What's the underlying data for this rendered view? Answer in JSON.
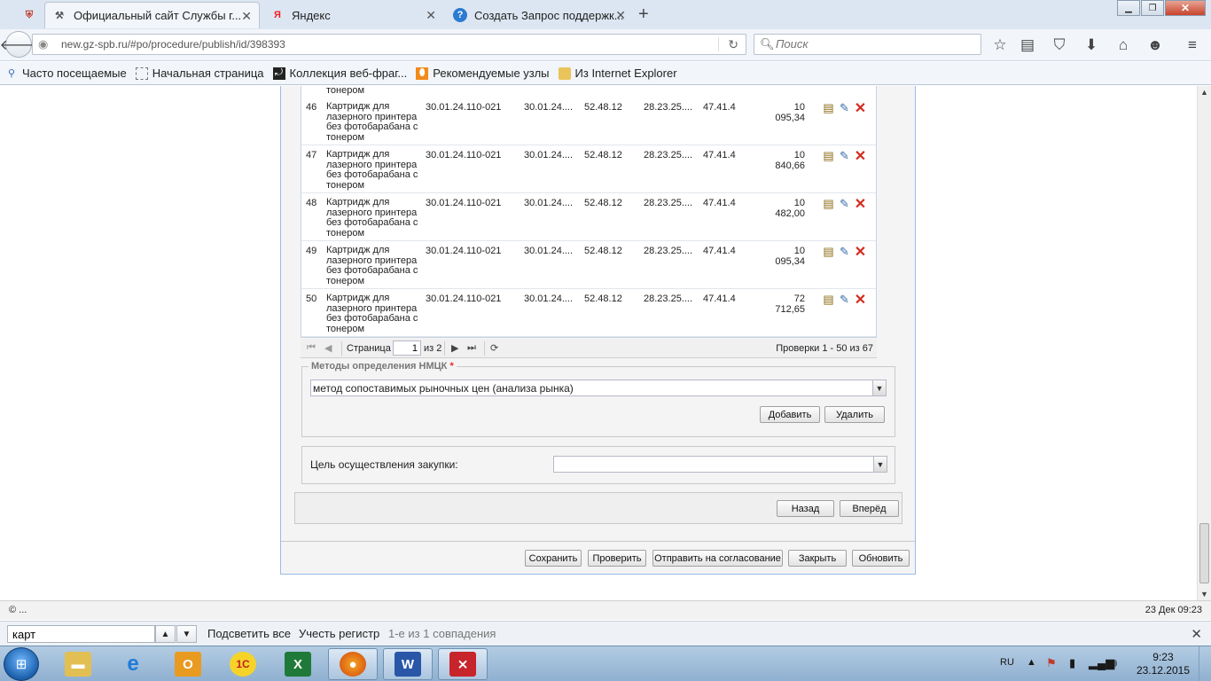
{
  "browser": {
    "tabs": [
      {
        "title": "Официальный сайт Службы г...",
        "active": true
      },
      {
        "title": "Яндекс",
        "active": false
      },
      {
        "title": "Создать Запрос поддержк...",
        "active": false
      }
    ],
    "new_tab": "+",
    "url": "new.gz-spb.ru/#po/procedure/publish/id/398393",
    "search_placeholder": "Поиск",
    "bookmarks": [
      "Часто посещаемые",
      "Начальная страница",
      "Коллекция веб-фраг...",
      "Рекомендуемые узлы",
      "Из Internet Explorer"
    ]
  },
  "grid": {
    "prev_row_tail": "тонером",
    "rows": [
      {
        "num": "46",
        "name": "Картридж для лазерного принтера без фотобарабана с тонером",
        "okpd": "30.01.24.110-021",
        "okpd2": "30.01.24....",
        "okved": "52.48.12",
        "code": "28.23.25....",
        "code2": "47.41.4",
        "price": "10 095,34"
      },
      {
        "num": "47",
        "name": "Картридж для лазерного принтера без фотобарабана с тонером",
        "okpd": "30.01.24.110-021",
        "okpd2": "30.01.24....",
        "okved": "52.48.12",
        "code": "28.23.25....",
        "code2": "47.41.4",
        "price": "10 840,66"
      },
      {
        "num": "48",
        "name": "Картридж для лазерного принтера без фотобарабана с тонером",
        "okpd": "30.01.24.110-021",
        "okpd2": "30.01.24....",
        "okved": "52.48.12",
        "code": "28.23.25....",
        "code2": "47.41.4",
        "price": "10 482,00"
      },
      {
        "num": "49",
        "name": "Картридж для лазерного принтера без фотобарабана с тонером",
        "okpd": "30.01.24.110-021",
        "okpd2": "30.01.24....",
        "okved": "52.48.12",
        "code": "28.23.25....",
        "code2": "47.41.4",
        "price": "10 095,34"
      },
      {
        "num": "50",
        "name": "Картридж для лазерного принтера без фотобарабана с тонером",
        "okpd": "30.01.24.110-021",
        "okpd2": "30.01.24....",
        "okved": "52.48.12",
        "code": "28.23.25....",
        "code2": "47.41.4",
        "price": "72 712,65"
      }
    ]
  },
  "pager": {
    "page_label": "Страница",
    "page_value": "1",
    "of_label": "из 2",
    "info": "Проверки 1 - 50 из 67"
  },
  "nmck": {
    "legend": "Методы определения НМЦК",
    "required_mark": "*",
    "selected": "метод сопоставимых рыночных цен (анализа рынка)",
    "add_label": "Добавить",
    "remove_label": "Удалить"
  },
  "purpose": {
    "label": "Цель осуществления закупки:",
    "value": ""
  },
  "wizard": {
    "back_label": "Назад",
    "next_label": "Вперёд"
  },
  "footer_buttons": {
    "save": "Сохранить",
    "check": "Проверить",
    "send": "Отправить на согласование",
    "close": "Закрыть",
    "refresh": "Обновить"
  },
  "status": {
    "left": "© ...",
    "right": "23 Дек 09:23"
  },
  "findbar": {
    "query": "карт",
    "highlight_all": "Подсветить все",
    "match_case": "Учесть регистр",
    "result": "1-е из 1 совпадения"
  },
  "taskbar": {
    "lang": "RU",
    "time": "9:23",
    "date": "23.12.2015"
  }
}
